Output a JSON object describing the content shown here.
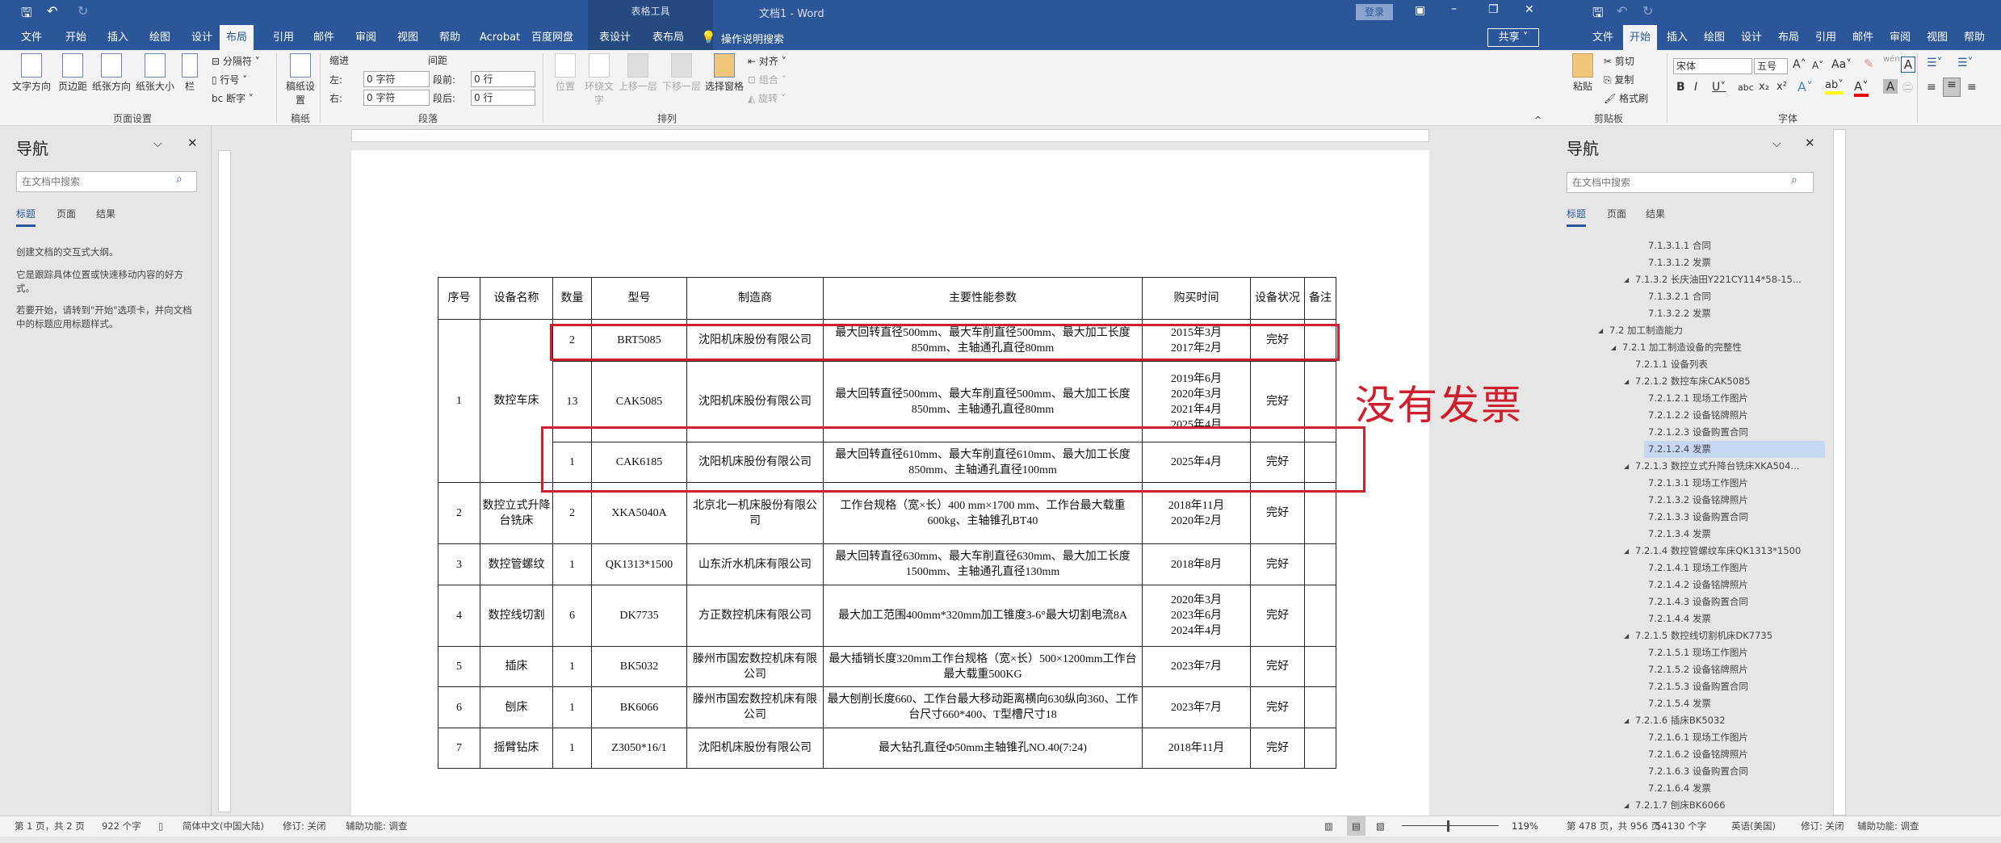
{
  "left_window": {
    "title": "文档1  -  Word",
    "context_tab_group": "表格工具",
    "login_button": "登录",
    "share_button": "共享",
    "tell_me": "操作说明搜索",
    "tabs": [
      "文件",
      "开始",
      "插入",
      "绘图",
      "设计",
      "布局",
      "引用",
      "邮件",
      "审阅",
      "视图",
      "帮助",
      "Acrobat",
      "百度网盘",
      "表设计",
      "表布局"
    ],
    "active_tab": "布局",
    "ribbon": {
      "page_setup": {
        "label": "页面设置",
        "buttons": [
          "文字方向",
          "页边距",
          "纸张方向",
          "纸张大小",
          "栏"
        ],
        "small": [
          "分隔符",
          "行号",
          "断字"
        ]
      },
      "manuscript": {
        "label": "稿纸",
        "button": "稿纸设置"
      },
      "paragraph": {
        "label": "段落",
        "indent": "缩进",
        "spacing": "间距",
        "left": "左:",
        "right": "右:",
        "before": "段前:",
        "after": "段后:",
        "left_value": "0 字符",
        "right_value": "0 字符",
        "before_value": "0 行",
        "after_value": "0 行"
      },
      "arrange": {
        "label": "排列",
        "buttons": [
          "位置",
          "环绕文字",
          "上移一层",
          "下移一层",
          "选择窗格"
        ],
        "small": [
          "对齐",
          "组合",
          "旋转"
        ]
      }
    },
    "nav": {
      "title": "导航",
      "search_placeholder": "在文档中搜索",
      "tabs": [
        "标题",
        "页面",
        "结果"
      ],
      "hints": [
        "创建文档的交互式大纲。",
        "它是跟踪具体位置或快速移动内容的好方式。",
        "若要开始，请转到\"开始\"选项卡，并向文档中的标题应用标题样式。"
      ]
    },
    "status": {
      "page": "第 1 页，共 2 页",
      "words": "922 个字",
      "language": "简体中文(中国大陆)",
      "track": "修订: 关闭",
      "accessibility": "辅助功能: 调查"
    }
  },
  "table": {
    "headers": [
      "序号",
      "设备名称",
      "数量",
      "型号",
      "制造商",
      "主要性能参数",
      "购买时间",
      "设备状况",
      "备注"
    ],
    "rows": [
      {
        "no": "1",
        "name": "数控车床",
        "qty": "2",
        "model": "BRT5085",
        "maker": "沈阳机床股份有限公司",
        "params": "最大回转直径500mm、最大车削直径500mm、最大加工长度850mm、主轴通孔直径80mm",
        "date": "2015年3月 2017年2月",
        "status": "完好",
        "remark": ""
      },
      {
        "no": "",
        "name": "",
        "qty": "13",
        "model": "CAK5085",
        "maker": "沈阳机床股份有限公司",
        "params": "最大回转直径500mm、最大车削直径500mm、最大加工长度850mm、主轴通孔直径80mm",
        "date": "2019年6月 2020年3月 2021年4月 2025年4月",
        "status": "完好",
        "remark": ""
      },
      {
        "no": "",
        "name": "",
        "qty": "1",
        "model": "CAK6185",
        "maker": "沈阳机床股份有限公司",
        "params": "最大回转直径610mm、最大车削直径610mm、最大加工长度850mm、主轴通孔直径100mm",
        "date": "2025年4月",
        "status": "完好",
        "remark": ""
      },
      {
        "no": "2",
        "name": "数控立式升降台铣床",
        "qty": "2",
        "model": "XKA5040A",
        "maker": "北京北一机床股份有限公司",
        "params": "工作台规格（宽×长）400 mm×1700 mm、工作台最大载重600kg、主轴锥孔BT40",
        "date": "2018年11月 2020年2月",
        "status": "完好",
        "remark": ""
      },
      {
        "no": "3",
        "name": "数控管螺纹",
        "qty": "1",
        "model": "QK1313*1500",
        "maker": "山东沂水机床有限公司",
        "params": "最大回转直径630mm、最大车削直径630mm、最大加工长度1500mm、主轴通孔直径130mm",
        "date": "2018年8月",
        "status": "完好",
        "remark": ""
      },
      {
        "no": "4",
        "name": "数控线切割",
        "qty": "6",
        "model": "DK7735",
        "maker": "方正数控机床有限公司",
        "params": "最大加工范围400mm*320mm加工锥度3-6°最大切割电流8A",
        "date": "2020年3月 2023年6月 2024年4月",
        "status": "完好",
        "remark": ""
      },
      {
        "no": "5",
        "name": "插床",
        "qty": "1",
        "model": "BK5032",
        "maker": "滕州市国宏数控机床有限公司",
        "params": "最大插销长度320mm工作台规格（宽×长）500×1200mm工作台最大载重500KG",
        "date": "2023年7月",
        "status": "完好",
        "remark": ""
      },
      {
        "no": "6",
        "name": "刨床",
        "qty": "1",
        "model": "BK6066",
        "maker": "滕州市国宏数控机床有限公司",
        "params": "最大刨削长度660、工作台最大移动距离横向630纵向360、工作台尺寸660*400、T型槽尺寸18",
        "date": "2023年7月",
        "status": "完好",
        "remark": ""
      },
      {
        "no": "7",
        "name": "摇臂钻床",
        "qty": "1",
        "model": "Z3050*16/1",
        "maker": "沈阳机床股份有限公司",
        "params": "最大钻孔直径Φ50mm主轴锥孔NO.40(7:24)",
        "date": "2018年11月",
        "status": "完好",
        "remark": ""
      }
    ]
  },
  "annotation": {
    "text": "没有发票",
    "color": "#d01f2c"
  },
  "right_window": {
    "tabs": [
      "文件",
      "开始",
      "插入",
      "绘图",
      "设计",
      "布局",
      "引用",
      "邮件",
      "审阅",
      "视图",
      "帮助"
    ],
    "active_tab": "开始",
    "clipboard": {
      "label": "剪贴板",
      "paste": "粘贴",
      "cut": "剪切",
      "copy": "复制",
      "format_painter": "格式刷"
    },
    "font": {
      "label": "字体",
      "font_name": "宋体",
      "font_size": "五号"
    },
    "nav": {
      "title": "导航",
      "search_placeholder": "在文档中搜索",
      "tabs": [
        "标题",
        "页面",
        "结果"
      ],
      "tree": [
        {
          "text": "7.1.3.1.1 合同",
          "level": 5
        },
        {
          "text": "7.1.3.1.2 发票",
          "level": 5
        },
        {
          "text": "7.1.3.2 长庆油田Y221CY114*58-15...",
          "level": 4,
          "expanded": true
        },
        {
          "text": "7.1.3.2.1 合同",
          "level": 5
        },
        {
          "text": "7.1.3.2.2 发票",
          "level": 5
        },
        {
          "text": "7.2 加工制造能力",
          "level": 2,
          "expanded": true
        },
        {
          "text": "7.2.1 加工制造设备的完整性",
          "level": 3,
          "expanded": true
        },
        {
          "text": "7.2.1.1 设备列表",
          "level": 4
        },
        {
          "text": "7.2.1.2 数控车床CAK5085",
          "level": 4,
          "expanded": true
        },
        {
          "text": "7.2.1.2.1 现场工作图片",
          "level": 5
        },
        {
          "text": "7.2.1.2.2 设备铭牌照片",
          "level": 5
        },
        {
          "text": "7.2.1.2.3 设备购置合同",
          "level": 5
        },
        {
          "text": "7.2.1.2.4 发票",
          "level": 5,
          "selected": true
        },
        {
          "text": "7.2.1.3 数控立式升降台铣床XKA504...",
          "level": 4,
          "expanded": true
        },
        {
          "text": "7.2.1.3.1 现场工作图片",
          "level": 5
        },
        {
          "text": "7.2.1.3.2 设备铭牌照片",
          "level": 5
        },
        {
          "text": "7.2.1.3.3 设备购置合同",
          "level": 5
        },
        {
          "text": "7.2.1.3.4 发票",
          "level": 5
        },
        {
          "text": "7.2.1.4 数控管螺纹车床QK1313*1500",
          "level": 4,
          "expanded": true
        },
        {
          "text": "7.2.1.4.1 现场工作图片",
          "level": 5
        },
        {
          "text": "7.2.1.4.2 设备铭牌照片",
          "level": 5
        },
        {
          "text": "7.2.1.4.3 设备购置合同",
          "level": 5
        },
        {
          "text": "7.2.1.4.4 发票",
          "level": 5
        },
        {
          "text": "7.2.1.5 数控线切割机床DK7735",
          "level": 4,
          "expanded": true
        },
        {
          "text": "7.2.1.5.1 现场工作图片",
          "level": 5
        },
        {
          "text": "7.2.1.5.2 设备铭牌照片",
          "level": 5
        },
        {
          "text": "7.2.1.5.3 设备购置合同",
          "level": 5
        },
        {
          "text": "7.2.1.5.4 发票",
          "level": 5
        },
        {
          "text": "7.2.1.6 插床BK5032",
          "level": 4,
          "expanded": true
        },
        {
          "text": "7.2.1.6.1 现场工作图片",
          "level": 5
        },
        {
          "text": "7.2.1.6.2 设备铭牌照片",
          "level": 5
        },
        {
          "text": "7.2.1.6.3 设备购置合同",
          "level": 5
        },
        {
          "text": "7.2.1.6.4 发票",
          "level": 5
        },
        {
          "text": "7.2.1.7 刨床BK6066",
          "level": 4,
          "expanded": true
        }
      ]
    },
    "status": {
      "zoom": "119%",
      "page": "第 478 页，共 956 页",
      "words": "54130 个字",
      "language": "英语(美国)",
      "track": "修订: 关闭",
      "accessibility": "辅助功能: 调查"
    }
  }
}
